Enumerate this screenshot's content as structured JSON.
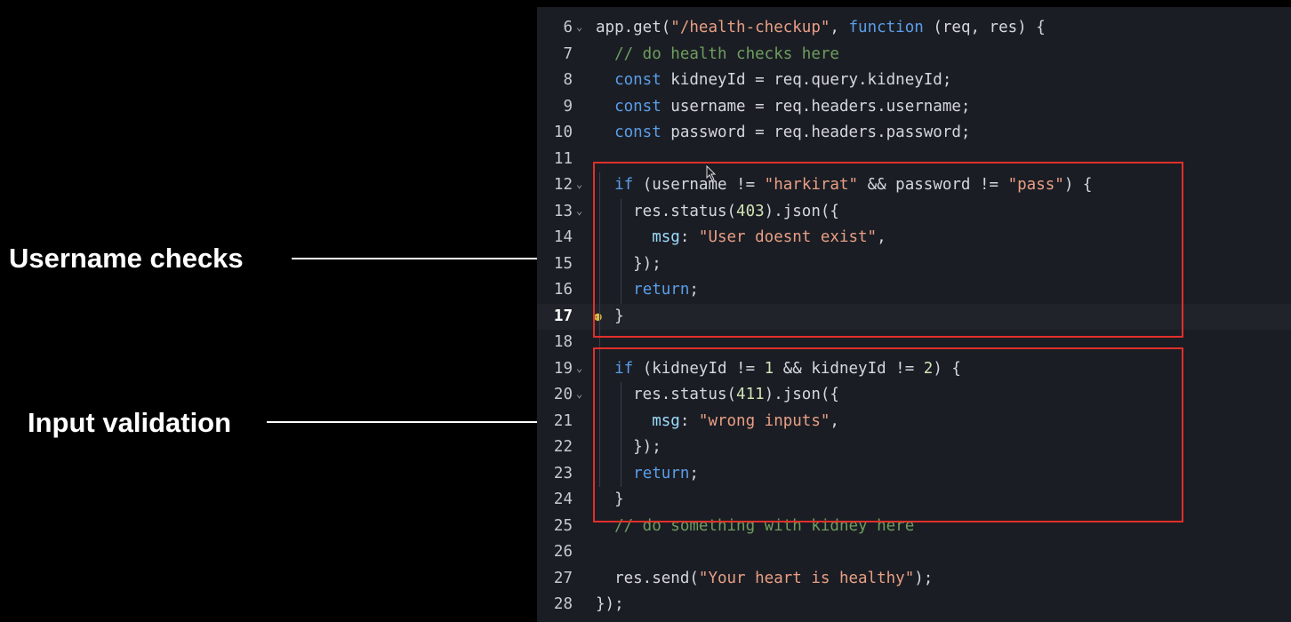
{
  "annotations": {
    "username_label": "Username checks",
    "input_label": "Input validation"
  },
  "editor": {
    "lines": [
      {
        "n": "6",
        "fold": "⌄",
        "code": [
          [
            "pl",
            "app.get("
          ],
          [
            "str",
            "\"/health-checkup\""
          ],
          [
            "pl",
            ", "
          ],
          [
            "kw",
            "function"
          ],
          [
            "pl",
            " (req, res) {"
          ]
        ]
      },
      {
        "n": "7",
        "code": [
          [
            "pl",
            "  "
          ],
          [
            "cm",
            "// do health checks here"
          ]
        ]
      },
      {
        "n": "8",
        "code": [
          [
            "pl",
            "  "
          ],
          [
            "kw",
            "const"
          ],
          [
            "pl",
            " kidneyId = req.query.kidneyId;"
          ]
        ]
      },
      {
        "n": "9",
        "code": [
          [
            "pl",
            "  "
          ],
          [
            "kw",
            "const"
          ],
          [
            "pl",
            " username = req.headers.username;"
          ]
        ]
      },
      {
        "n": "10",
        "code": [
          [
            "pl",
            "  "
          ],
          [
            "kw",
            "const"
          ],
          [
            "pl",
            " password = req.headers.password;"
          ]
        ]
      },
      {
        "n": "11",
        "code": []
      },
      {
        "n": "12",
        "fold": "⌄",
        "code": [
          [
            "pl",
            "  "
          ],
          [
            "kw",
            "if"
          ],
          [
            "pl",
            " (username != "
          ],
          [
            "str",
            "\"harkirat\""
          ],
          [
            "pl",
            " && password != "
          ],
          [
            "str",
            "\"pass\""
          ],
          [
            "pl",
            ") {"
          ]
        ]
      },
      {
        "n": "13",
        "fold": "⌄",
        "code": [
          [
            "pl",
            "    res.status("
          ],
          [
            "num",
            "403"
          ],
          [
            "pl",
            ").json({"
          ]
        ]
      },
      {
        "n": "14",
        "code": [
          [
            "pl",
            "      "
          ],
          [
            "var",
            "msg"
          ],
          [
            "pl",
            ": "
          ],
          [
            "str",
            "\"User doesnt exist\""
          ],
          [
            "pl",
            ","
          ]
        ]
      },
      {
        "n": "15",
        "code": [
          [
            "pl",
            "    });"
          ]
        ]
      },
      {
        "n": "16",
        "code": [
          [
            "pl",
            "    "
          ],
          [
            "kw",
            "return"
          ],
          [
            "pl",
            ";"
          ]
        ]
      },
      {
        "n": "17",
        "current": true,
        "code": [
          [
            "pl",
            "  }"
          ]
        ]
      },
      {
        "n": "18",
        "code": []
      },
      {
        "n": "19",
        "fold": "⌄",
        "code": [
          [
            "pl",
            "  "
          ],
          [
            "kw",
            "if"
          ],
          [
            "pl",
            " (kidneyId != "
          ],
          [
            "num",
            "1"
          ],
          [
            "pl",
            " && kidneyId != "
          ],
          [
            "num",
            "2"
          ],
          [
            "pl",
            ") {"
          ]
        ]
      },
      {
        "n": "20",
        "fold": "⌄",
        "code": [
          [
            "pl",
            "    res.status("
          ],
          [
            "num",
            "411"
          ],
          [
            "pl",
            ").json({"
          ]
        ]
      },
      {
        "n": "21",
        "code": [
          [
            "pl",
            "      "
          ],
          [
            "var",
            "msg"
          ],
          [
            "pl",
            ": "
          ],
          [
            "str",
            "\"wrong inputs\""
          ],
          [
            "pl",
            ","
          ]
        ]
      },
      {
        "n": "22",
        "code": [
          [
            "pl",
            "    });"
          ]
        ]
      },
      {
        "n": "23",
        "code": [
          [
            "pl",
            "    "
          ],
          [
            "kw",
            "return"
          ],
          [
            "pl",
            ";"
          ]
        ]
      },
      {
        "n": "24",
        "code": [
          [
            "pl",
            "  }"
          ]
        ]
      },
      {
        "n": "25",
        "code": [
          [
            "pl",
            "  "
          ],
          [
            "cm",
            "// do something with kidney here"
          ]
        ]
      },
      {
        "n": "26",
        "code": []
      },
      {
        "n": "27",
        "code": [
          [
            "pl",
            "  res.send("
          ],
          [
            "str",
            "\"Your heart is healthy\""
          ],
          [
            "pl",
            ");"
          ]
        ]
      },
      {
        "n": "28",
        "code": [
          [
            "pl",
            "});"
          ]
        ]
      }
    ]
  },
  "colors": {
    "highlight_box": "#e0302a",
    "editor_bg": "#1b1d24",
    "keyword": "#5a9ee8",
    "string": "#e89f84"
  }
}
